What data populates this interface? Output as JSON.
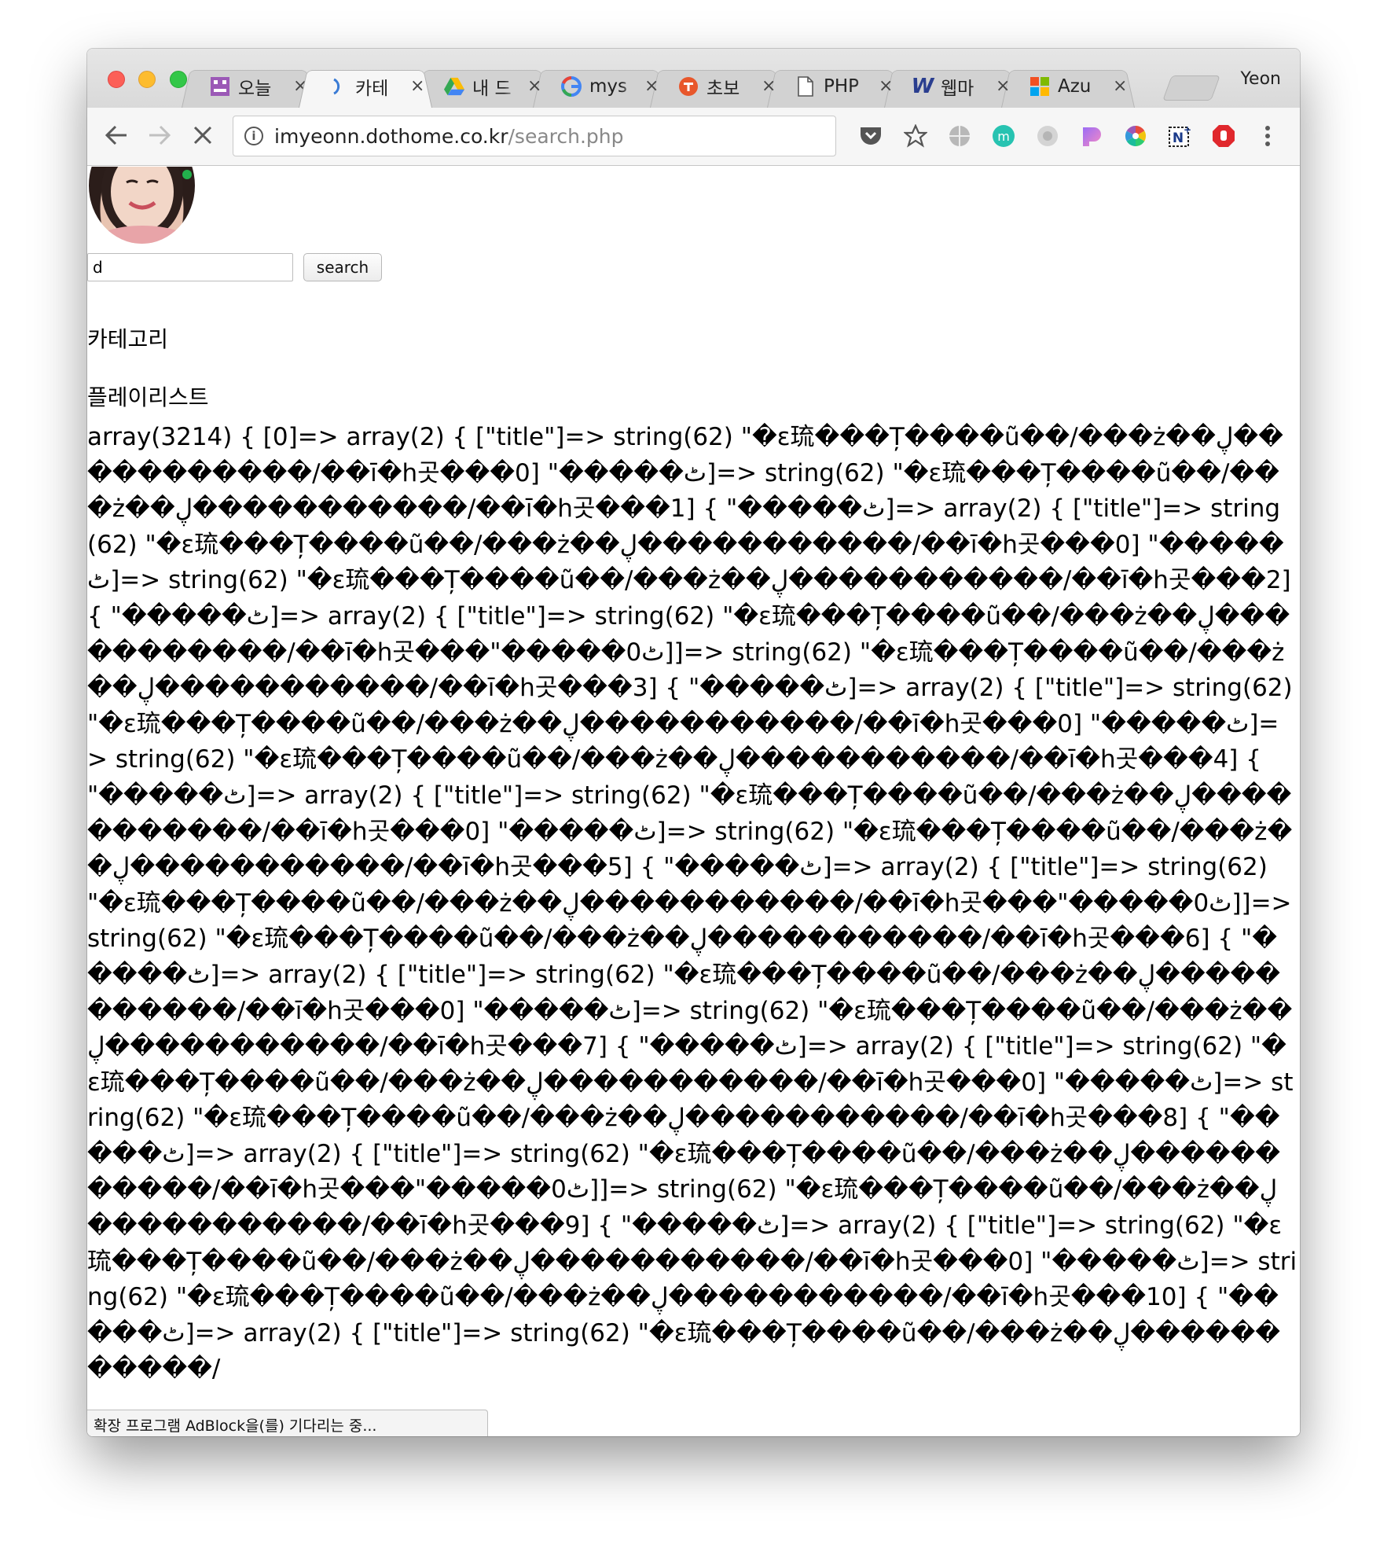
{
  "browser": {
    "tabs": [
      {
        "label": "오늘",
        "favicon": "grid-face-icon",
        "active": false
      },
      {
        "label": "카테",
        "favicon": "loading-spinner-icon",
        "active": true
      },
      {
        "label": "내 드",
        "favicon": "google-drive-icon",
        "active": false
      },
      {
        "label": "mys",
        "favicon": "google-g-icon",
        "active": false
      },
      {
        "label": "초보",
        "favicon": "orange-t-icon",
        "active": false
      },
      {
        "label": "PHP",
        "favicon": "document-icon",
        "active": false
      },
      {
        "label": "웹마",
        "favicon": "w-logo-icon",
        "active": false
      },
      {
        "label": "Azu",
        "favicon": "microsoft-logo-icon",
        "active": false
      }
    ],
    "tab_close_glyph": "×",
    "profile_name": "Yeon",
    "url_host": "imyeonn.dothome.co.kr",
    "url_path": "/search.php",
    "status_text": "확장 프로그램 AdBlock을(를) 기다리는 중..."
  },
  "page": {
    "search_value": "d",
    "search_button": "search",
    "category_heading": "카테고리",
    "playlist_heading": "플레이리스트",
    "dump_text": "array(3214) { [0]=> array(2) { [\"title\"]=> string(62) \"�ε琉���Ț����ũ��/���ż��ڸ�����������/��ī�h곳���0] \"�����ٹ]=> string(62) \"�ε琉���Ț����ũ��/���ż��ڸ�����������/��ī�h곳���1] { \"�����ٹ]=> array(2) { [\"title\"]=> string(62) \"�ε琉���Ț����ũ��/���ż��ڸ�����������/��ī�h곳���0] \"�����ٹ]=> string(62) \"�ε琉���Ț����ũ��/���ż��ڸ�����������/��ī�h곳���2] { \"�����ٹ]=> array(2) { [\"title\"]=> string(62) \"�ε琉���Ț����ũ��/���ż��ڸ�����������/��ī�h곳���\"�����ٹ0]]=> string(62) \"�ε琉���Ț����ũ��/���ż��ڸ�����������/��ī�h곳���3] { \"�����ٹ]=> array(2) { [\"title\"]=> string(62) \"�ε琉���Ț����ũ��/���ż��ڸ�����������/��ī�h곳���0] \"�����ٹ]=> string(62) \"�ε琉���Ț����ũ��/���ż��ڸ�����������/��ī�h곳���4] { \"�����ٹ]=> array(2) { [\"title\"]=> string(62) \"�ε琉���Ț����ũ��/���ż��ڸ�����������/��ī�h곳���0] \"�����ٹ]=> string(62) \"�ε琉���Ț����ũ��/���ż��ڸ�����������/��ī�h곳���5] { \"�����ٹ]=> array(2) { [\"title\"]=> string(62) \"�ε琉���Ț����ũ��/���ż��ڸ�����������/��ī�h곳���\"�����ٹ0]]=> string(62) \"�ε琉���Ț����ũ��/���ż��ڸ�����������/��ī�h곳���6] { \"�����ٹ]=> array(2) { [\"title\"]=> string(62) \"�ε琉���Ț����ũ��/���ż��ڸ�����������/��ī�h곳���0] \"�����ٹ]=> string(62) \"�ε琉���Ț����ũ��/���ż��ڸ�����������/��ī�h곳���7] { \"�����ٹ]=> array(2) { [\"title\"]=> string(62) \"�ε琉���Ț����ũ��/���ż��ڸ�����������/��ī�h곳���0] \"�����ٹ]=> string(62) \"�ε琉���Ț����ũ��/���ż��ڸ�����������/��ī�h곳���8] { \"�����ٹ]=> array(2) { [\"title\"]=> string(62) \"�ε琉���Ț����ũ��/���ż��ڸ�����������/��ī�h곳���\"�����ٹ0]]=> string(62) \"�ε琉���Ț����ũ��/���ż��ڸ�����������/��ī�h곳���9] { \"�����ٹ]=> array(2) { [\"title\"]=> string(62) \"�ε琉���Ț����ũ��/���ż��ڸ�����������/��ī�h곳���0] \"�����ٹ]=> string(62) \"�ε琉���Ț����ũ��/���ż��ڸ�����������/��ī�h곳���10] { \"�����ٹ]=> array(2) { [\"title\"]=> string(62) \"�ε琉���Ț����ũ��/���ż��ڸ�����������/"
  }
}
